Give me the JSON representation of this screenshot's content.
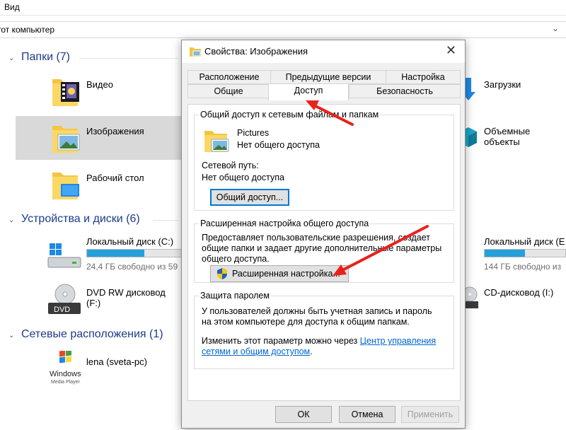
{
  "menubar": {
    "view_label": "Вид"
  },
  "address": {
    "path": "тот компьютер",
    "chevron": "⌄"
  },
  "groups": {
    "folders": {
      "title": "Папки (7)"
    },
    "devices": {
      "title": "Устройства и диски (6)"
    },
    "network": {
      "title": "Сетевые расположения (1)"
    }
  },
  "items": {
    "video": "Видео",
    "images": "Изображения",
    "desktop": "Рабочий стол",
    "downloads": "Загрузки",
    "objects3d": "Объемные объекты",
    "local_c": "Локальный диск (C:)",
    "local_c_free": "24,4 ГБ свободно из 59",
    "dvd_rw": "DVD RW дисковод (F:)",
    "dvd_icon_text": "DVD",
    "local_right": "Локальный диск (E",
    "local_right_free": "144 ГБ свободно из",
    "cd_drive": "CD-дисковод (I:)",
    "lena": "lena (sveta-pc)",
    "wmp_logo_text": "Windows",
    "wmp_logo_sub": "Media Player"
  },
  "disks": {
    "c_usage": 0.59,
    "right_usage": 0.5
  },
  "dialog": {
    "title": "Свойства: Изображения",
    "close": "✕",
    "tabs_row1": [
      "Расположение",
      "Предыдущие версии",
      "Настройка"
    ],
    "tabs_row2": [
      "Общие",
      "Доступ",
      "Безопасность"
    ],
    "share_group": {
      "legend": "Общий доступ к сетевым файлам и папкам",
      "folder_name": "Pictures",
      "folder_status": "Нет общего доступа",
      "network_path_label": "Сетевой путь:",
      "network_path_value": "Нет общего доступа",
      "button": "Общий доступ..."
    },
    "advanced_group": {
      "legend": "Расширенная настройка общего доступа",
      "description": "Предоставляет пользовательские разрешения, создает общие папки и задает другие дополнительные параметры общего доступа.",
      "button": "Расширенная настройка..."
    },
    "password_group": {
      "legend": "Защита паролем",
      "description": "У пользователей должны быть учетная запись и пароль на этом компьютере для доступа к общим папкам.",
      "change_prefix": "Изменить этот параметр можно через ",
      "link_line1": "Центр управления",
      "link_line2": "сетями и общим доступом",
      "suffix": "."
    },
    "buttons": {
      "ok": "ОК",
      "cancel": "Отмена",
      "apply": "Применить"
    }
  },
  "colors": {
    "accent": "#0078d7",
    "arrow": "#e8211b",
    "group_header": "#1e3a8a"
  }
}
